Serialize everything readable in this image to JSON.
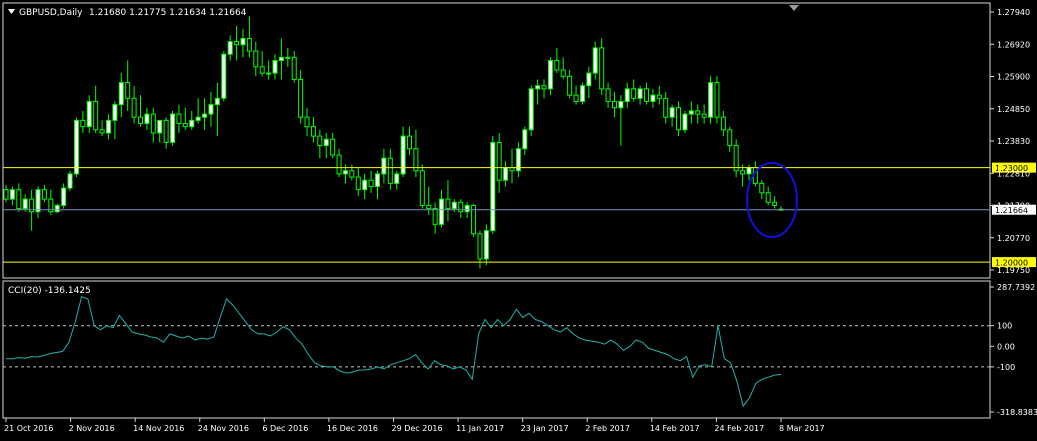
{
  "chart_data": [
    {
      "type": "candlestick",
      "symbol_label": "GBPUSD,Daily",
      "ohlc_label": "1.21680 1.21775 1.21634 1.21664",
      "ylim": [
        1.1975,
        1.2794
      ],
      "y_ticks": [
        "1.27940",
        "1.26920",
        "1.25900",
        "1.24850",
        "1.23830",
        "1.22810",
        "1.21790",
        "1.20770",
        "1.19750"
      ],
      "x_labels": [
        "21 Oct 2016",
        "2 Nov 2016",
        "14 Nov 2016",
        "24 Nov 2016",
        "6 Dec 2016",
        "16 Dec 2016",
        "29 Dec 2016",
        "11 Jan 2017",
        "23 Jan 2017",
        "2 Feb 2017",
        "14 Feb 2017",
        "24 Feb 2017",
        "8 Mar 2017"
      ],
      "horizontal_lines": [
        {
          "label": "1.23000",
          "value": 1.23,
          "color": "#ffff00"
        },
        {
          "label": "1.20000",
          "value": 1.2,
          "color": "#ffff00"
        },
        {
          "label": "1.21664",
          "value": 1.21664,
          "color": "#7f8fbf"
        }
      ],
      "candles": [
        [
          1.223,
          1.2245,
          1.219,
          1.22
        ],
        [
          1.22,
          1.224,
          1.218,
          1.223
        ],
        [
          1.223,
          1.225,
          1.216,
          1.217
        ],
        [
          1.217,
          1.2215,
          1.216,
          1.22
        ],
        [
          1.22,
          1.223,
          1.21,
          1.216
        ],
        [
          1.216,
          1.224,
          1.214,
          1.223
        ],
        [
          1.223,
          1.2245,
          1.219,
          1.22
        ],
        [
          1.22,
          1.223,
          1.215,
          1.216
        ],
        [
          1.216,
          1.2185,
          1.2155,
          1.218
        ],
        [
          1.218,
          1.225,
          1.217,
          1.2235
        ],
        [
          1.2235,
          1.229,
          1.2225,
          1.228
        ],
        [
          1.228,
          1.246,
          1.227,
          1.245
        ],
        [
          1.245,
          1.248,
          1.241,
          1.243
        ],
        [
          1.243,
          1.253,
          1.241,
          1.251
        ],
        [
          1.251,
          1.256,
          1.241,
          1.242
        ],
        [
          1.242,
          1.245,
          1.24,
          1.241
        ],
        [
          1.241,
          1.247,
          1.239,
          1.245
        ],
        [
          1.245,
          1.251,
          1.239,
          1.25
        ],
        [
          1.25,
          1.26,
          1.246,
          1.257
        ],
        [
          1.257,
          1.264,
          1.248,
          1.252
        ],
        [
          1.252,
          1.256,
          1.244,
          1.246
        ],
        [
          1.246,
          1.253,
          1.243,
          1.244
        ],
        [
          1.244,
          1.249,
          1.242,
          1.247
        ],
        [
          1.247,
          1.249,
          1.238,
          1.241
        ],
        [
          1.241,
          1.245,
          1.238,
          1.245
        ],
        [
          1.245,
          1.246,
          1.236,
          1.238
        ],
        [
          1.238,
          1.248,
          1.237,
          1.247
        ],
        [
          1.247,
          1.25,
          1.241,
          1.244
        ],
        [
          1.244,
          1.249,
          1.242,
          1.243
        ],
        [
          1.243,
          1.248,
          1.242,
          1.245
        ],
        [
          1.245,
          1.252,
          1.244,
          1.246
        ],
        [
          1.246,
          1.252,
          1.242,
          1.247
        ],
        [
          1.247,
          1.254,
          1.243,
          1.25
        ],
        [
          1.25,
          1.257,
          1.24,
          1.252
        ],
        [
          1.252,
          1.267,
          1.251,
          1.266
        ],
        [
          1.266,
          1.272,
          1.264,
          1.27
        ],
        [
          1.27,
          1.275,
          1.264,
          1.269
        ],
        [
          1.269,
          1.274,
          1.265,
          1.271
        ],
        [
          1.271,
          1.278,
          1.265,
          1.267
        ],
        [
          1.267,
          1.27,
          1.259,
          1.262
        ],
        [
          1.262,
          1.267,
          1.259,
          1.26
        ],
        [
          1.26,
          1.264,
          1.258,
          1.26
        ],
        [
          1.26,
          1.266,
          1.258,
          1.264
        ],
        [
          1.264,
          1.271,
          1.258,
          1.265
        ],
        [
          1.265,
          1.268,
          1.262,
          1.265
        ],
        [
          1.265,
          1.267,
          1.257,
          1.258
        ],
        [
          1.258,
          1.261,
          1.244,
          1.246
        ],
        [
          1.246,
          1.249,
          1.24,
          1.243
        ],
        [
          1.243,
          1.246,
          1.238,
          1.24
        ],
        [
          1.24,
          1.242,
          1.233,
          1.237
        ],
        [
          1.237,
          1.241,
          1.233,
          1.239
        ],
        [
          1.239,
          1.241,
          1.233,
          1.234
        ],
        [
          1.234,
          1.236,
          1.227,
          1.228
        ],
        [
          1.228,
          1.231,
          1.225,
          1.229
        ],
        [
          1.229,
          1.231,
          1.226,
          1.227
        ],
        [
          1.227,
          1.23,
          1.221,
          1.223
        ],
        [
          1.223,
          1.228,
          1.22,
          1.226
        ],
        [
          1.226,
          1.229,
          1.222,
          1.224
        ],
        [
          1.224,
          1.229,
          1.22,
          1.228
        ],
        [
          1.228,
          1.236,
          1.225,
          1.233
        ],
        [
          1.233,
          1.236,
          1.223,
          1.225
        ],
        [
          1.225,
          1.229,
          1.223,
          1.228
        ],
        [
          1.228,
          1.243,
          1.227,
          1.24
        ],
        [
          1.24,
          1.243,
          1.234,
          1.236
        ],
        [
          1.236,
          1.242,
          1.227,
          1.229
        ],
        [
          1.229,
          1.231,
          1.217,
          1.218
        ],
        [
          1.218,
          1.224,
          1.215,
          1.217
        ],
        [
          1.217,
          1.219,
          1.209,
          1.212
        ],
        [
          1.212,
          1.223,
          1.211,
          1.22
        ],
        [
          1.22,
          1.226,
          1.213,
          1.217
        ],
        [
          1.217,
          1.22,
          1.216,
          1.219
        ],
        [
          1.219,
          1.22,
          1.214,
          1.216
        ],
        [
          1.216,
          1.219,
          1.214,
          1.218
        ],
        [
          1.218,
          1.2185,
          1.208,
          1.209
        ],
        [
          1.209,
          1.21,
          1.198,
          1.201
        ],
        [
          1.201,
          1.212,
          1.199,
          1.21
        ],
        [
          1.21,
          1.24,
          1.209,
          1.238
        ],
        [
          1.238,
          1.241,
          1.222,
          1.226
        ],
        [
          1.226,
          1.232,
          1.224,
          1.23
        ],
        [
          1.23,
          1.236,
          1.225,
          1.229
        ],
        [
          1.229,
          1.238,
          1.227,
          1.236
        ],
        [
          1.236,
          1.243,
          1.234,
          1.242
        ],
        [
          1.242,
          1.256,
          1.24,
          1.255
        ],
        [
          1.255,
          1.258,
          1.25,
          1.256
        ],
        [
          1.256,
          1.258,
          1.252,
          1.255
        ],
        [
          1.255,
          1.265,
          1.253,
          1.264
        ],
        [
          1.264,
          1.268,
          1.26,
          1.261
        ],
        [
          1.261,
          1.265,
          1.258,
          1.259
        ],
        [
          1.259,
          1.261,
          1.252,
          1.253
        ],
        [
          1.253,
          1.256,
          1.25,
          1.251
        ],
        [
          1.251,
          1.257,
          1.25,
          1.256
        ],
        [
          1.256,
          1.262,
          1.252,
          1.26
        ],
        [
          1.26,
          1.27,
          1.258,
          1.268
        ],
        [
          1.268,
          1.271,
          1.253,
          1.255
        ],
        [
          1.255,
          1.257,
          1.249,
          1.251
        ],
        [
          1.251,
          1.254,
          1.246,
          1.249
        ],
        [
          1.249,
          1.253,
          1.237,
          1.251
        ],
        [
          1.251,
          1.257,
          1.249,
          1.255
        ],
        [
          1.255,
          1.258,
          1.251,
          1.252
        ],
        [
          1.252,
          1.256,
          1.25,
          1.255
        ],
        [
          1.255,
          1.257,
          1.25,
          1.251
        ],
        [
          1.251,
          1.255,
          1.249,
          1.253
        ],
        [
          1.253,
          1.256,
          1.25,
          1.252
        ],
        [
          1.252,
          1.254,
          1.244,
          1.246
        ],
        [
          1.246,
          1.25,
          1.243,
          1.249
        ],
        [
          1.249,
          1.251,
          1.24,
          1.242
        ],
        [
          1.242,
          1.248,
          1.241,
          1.247
        ],
        [
          1.247,
          1.251,
          1.244,
          1.248
        ],
        [
          1.248,
          1.25,
          1.244,
          1.247
        ],
        [
          1.247,
          1.25,
          1.244,
          1.246
        ],
        [
          1.246,
          1.259,
          1.244,
          1.257
        ],
        [
          1.257,
          1.259,
          1.244,
          1.246
        ],
        [
          1.246,
          1.248,
          1.24,
          1.242
        ],
        [
          1.242,
          1.243,
          1.235,
          1.237
        ],
        [
          1.237,
          1.239,
          1.227,
          1.229
        ],
        [
          1.229,
          1.231,
          1.224,
          1.228
        ],
        [
          1.228,
          1.231,
          1.226,
          1.23
        ],
        [
          1.23,
          1.232,
          1.224,
          1.225
        ],
        [
          1.225,
          1.226,
          1.22,
          1.222
        ],
        [
          1.222,
          1.224,
          1.218,
          1.219
        ],
        [
          1.219,
          1.221,
          1.217,
          1.218
        ],
        [
          1.2168,
          1.21775,
          1.21634,
          1.21664
        ]
      ],
      "indicator": {
        "label": "CCI(20) -136.1425",
        "ylim": [
          -318.8383,
          287.7392
        ],
        "y_ticks": [
          "287.7392",
          "100",
          "0.00",
          "-100",
          "-318.8383"
        ],
        "levels": [
          100,
          -100
        ],
        "values": [
          -60,
          -60,
          -55,
          -58,
          -50,
          -52,
          -45,
          -35,
          -30,
          -25,
          20,
          120,
          240,
          230,
          100,
          80,
          100,
          90,
          150,
          110,
          70,
          60,
          55,
          45,
          40,
          20,
          60,
          50,
          40,
          50,
          30,
          40,
          35,
          45,
          140,
          230,
          200,
          160,
          120,
          80,
          60,
          60,
          50,
          70,
          95,
          80,
          40,
          10,
          -40,
          -80,
          -95,
          -100,
          -100,
          -120,
          -130,
          -125,
          -115,
          -115,
          -110,
          -100,
          -110,
          -90,
          -80,
          -70,
          -60,
          -40,
          -80,
          -110,
          -70,
          -90,
          -95,
          -110,
          -100,
          -115,
          -160,
          60,
          130,
          90,
          130,
          100,
          130,
          180,
          140,
          160,
          130,
          120,
          100,
          80,
          70,
          90,
          60,
          40,
          30,
          25,
          20,
          10,
          30,
          10,
          -20,
          0,
          30,
          20,
          -10,
          -20,
          -30,
          -40,
          -60,
          -70,
          -50,
          -150,
          -95,
          -90,
          -100,
          100,
          -60,
          -80,
          -170,
          -290,
          -250,
          -180,
          -160,
          -150,
          -140,
          -136.1425
        ]
      }
    }
  ]
}
